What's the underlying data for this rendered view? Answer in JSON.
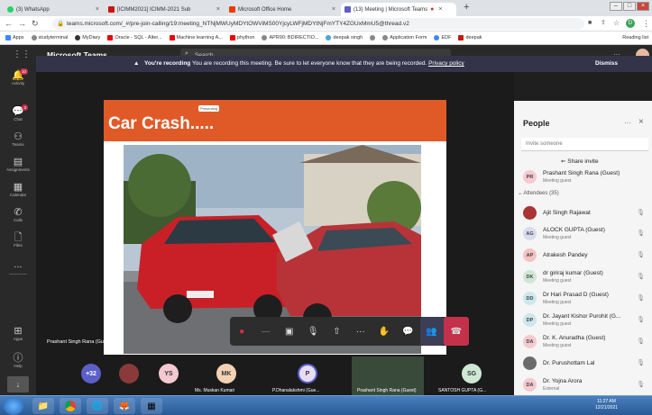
{
  "browser": {
    "tabs": [
      {
        "label": "(3) WhatsApp",
        "color": "#25d366"
      },
      {
        "label": "[ICIMM2021] ICIMM-2021 Sub",
        "color": "#c71610"
      },
      {
        "label": "Microsoft Office Home",
        "color": "#eb3c00"
      },
      {
        "label": "(13) Meeting | Microsoft Teams",
        "color": "#5b5fc7"
      }
    ],
    "new_tab": "+",
    "url": "teams.microsoft.com/_#/pre-join-calling/19:meeting_NTNjMWUyMDYtOWViMS00YjcyLWFjMDYtNjFmYTY4ZGUxMmU5@thread.v2",
    "bookmarks": [
      "Apps",
      "studyterminal",
      "MyDiary",
      "Oracle - SQL - Alter...",
      "Machine learning A...",
      "phython",
      "APR90: BDIRECTIO...",
      "deepak singh",
      "",
      "Application Form",
      "EDF",
      "deepak"
    ],
    "reading_list": "Reading list"
  },
  "teams": {
    "app_name": "Microsoft Teams",
    "search_placeholder": "Search",
    "banner": {
      "bold": "You're recording",
      "text": "You are recording this meeting. Be sure to let everyone know that they are being recorded.",
      "link": "Privacy policy",
      "dismiss": "Dismiss"
    },
    "rail": [
      {
        "label": "Activity",
        "icon": "bell-icon",
        "badge": "10"
      },
      {
        "label": "Chat",
        "icon": "chat-icon",
        "badge": "3"
      },
      {
        "label": "Teams",
        "icon": "teams-icon",
        "badge": ""
      },
      {
        "label": "Assignments",
        "icon": "assignments-icon",
        "badge": ""
      },
      {
        "label": "Calendar",
        "icon": "calendar-icon",
        "badge": ""
      },
      {
        "label": "Calls",
        "icon": "phone-icon",
        "badge": ""
      },
      {
        "label": "Files",
        "icon": "files-icon",
        "badge": ""
      },
      {
        "label": "...",
        "icon": "more-icon",
        "badge": ""
      }
    ],
    "rail_bottom": [
      {
        "label": "Apps",
        "icon": "apps-icon"
      },
      {
        "label": "Help",
        "icon": "help-icon"
      }
    ]
  },
  "slide": {
    "title": "Car Crash.....",
    "mini_label": "Presenting"
  },
  "presenter_label": "Prashant Singh Rana (Guest)",
  "controls": [
    "camera-off",
    "mic-off",
    "share",
    "more",
    "raise-hand",
    "chat",
    "people",
    "leave"
  ],
  "participants_strip": [
    {
      "initials": "+32",
      "name": "",
      "color": "#5b5fc7"
    },
    {
      "initials": "",
      "name": "",
      "color": "#8a3a3a"
    },
    {
      "initials": "YS",
      "name": "",
      "color": "#f4c9cf"
    },
    {
      "initials": "MK",
      "name": "Ms. Muskan Kumari",
      "color": "#f3d2b4"
    },
    {
      "initials": "P",
      "name": "P.Dhanalakshmi (Gue...",
      "color": "#e6ddf5"
    },
    {
      "initials": "",
      "name": "Prashant Singh Rana (Guest)",
      "color": "#3a4a3a"
    },
    {
      "initials": "SG",
      "name": "SANTOSH GUPTA (G...",
      "color": "#cfe8d4"
    }
  ],
  "people_panel": {
    "title": "People",
    "invite_placeholder": "Invite someone",
    "share_invite": "Share invite",
    "organizer": {
      "initials": "PR",
      "name": "Prashant Singh Rana (Guest)",
      "sub": "Meeting guest"
    },
    "attendees_header": "Attendees (35)",
    "attendees": [
      {
        "initials": "",
        "name": "Ajit Singh Rajawat",
        "sub": "",
        "color": "#a33"
      },
      {
        "initials": "AG",
        "name": "ALOCK GUPTA (Guest)",
        "sub": "Meeting guest",
        "color": "#d8dcef"
      },
      {
        "initials": "AP",
        "name": "Atrakesh Pandey",
        "sub": "",
        "color": "#f4c2c2"
      },
      {
        "initials": "DK",
        "name": "dr giriraj kumar (Guest)",
        "sub": "Meeting guest",
        "color": "#cfe8d4"
      },
      {
        "initials": "DD",
        "name": "Dr Hari Prasad D (Guest)",
        "sub": "Meeting guest",
        "color": "#cde7ee"
      },
      {
        "initials": "DP",
        "name": "Dr. Jayant Kishor Purohit (G...",
        "sub": "Meeting guest",
        "color": "#cde7ee"
      },
      {
        "initials": "DA",
        "name": "Dr. K. Anuradha (Guest)",
        "sub": "Meeting guest",
        "color": "#f4c9cf"
      },
      {
        "initials": "",
        "name": "Dr. Purushottam Lal",
        "sub": "",
        "color": "#6b6b6b"
      },
      {
        "initials": "DA",
        "name": "Dr. Yojna Arora",
        "sub": "External",
        "color": "#f4c9cf"
      }
    ]
  },
  "clock": {
    "time": "11:27 AM",
    "date": "12/21/2021"
  }
}
